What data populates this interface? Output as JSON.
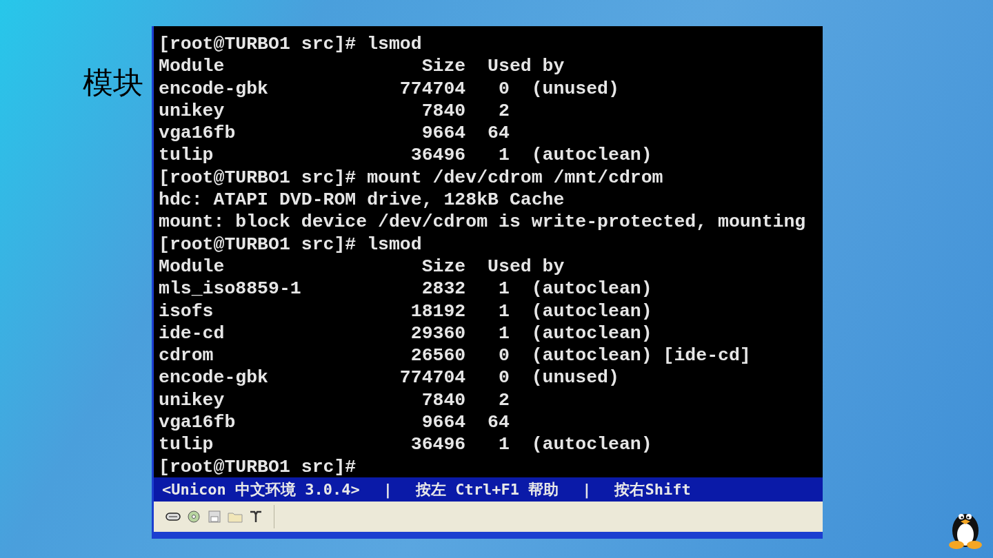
{
  "slide": {
    "title": "模块"
  },
  "terminal": {
    "lines": [
      "[root@TURBO1 src]# lsmod",
      "Module                  Size  Used by",
      "encode-gbk            774704   0  (unused)",
      "unikey                  7840   2",
      "vga16fb                 9664  64",
      "tulip                  36496   1  (autoclean)",
      "[root@TURBO1 src]# mount /dev/cdrom /mnt/cdrom",
      "hdc: ATAPI DVD-ROM drive, 128kB Cache",
      "mount: block device /dev/cdrom is write-protected, mounting",
      "[root@TURBO1 src]# lsmod",
      "Module                  Size  Used by",
      "mls_iso8859-1           2832   1  (autoclean)",
      "isofs                  18192   1  (autoclean)",
      "ide-cd                 29360   1  (autoclean)",
      "cdrom                  26560   0  (autoclean) [ide-cd]",
      "encode-gbk            774704   0  (unused)",
      "unikey                  7840   2",
      "vga16fb                 9664  64",
      "tulip                  36496   1  (autoclean)",
      "[root@TURBO1 src]#"
    ],
    "status_bar": [
      "<Unicon 中文环境 3.0.4>",
      "|",
      "按左 Ctrl+F1 帮助",
      "|",
      "按右Shift"
    ]
  }
}
